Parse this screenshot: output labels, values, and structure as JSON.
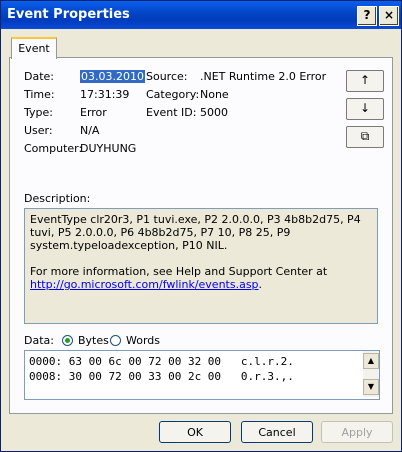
{
  "window": {
    "title": "Event Properties"
  },
  "titlebar": {
    "help": "?",
    "close": "×"
  },
  "tabs": [
    {
      "label": "Event"
    }
  ],
  "event": {
    "date_label": "Date:",
    "date": "03.03.2010",
    "time_label": "Time:",
    "time": "17:31:39",
    "type_label": "Type:",
    "type": "Error",
    "user_label": "User:",
    "user": "N/A",
    "computer_label": "Computer:",
    "computer": "DUYHUNG",
    "source_label": "Source:",
    "source": ".NET Runtime 2.0 Error",
    "category_label": "Category:",
    "category": "None",
    "eventid_label": "Event ID:",
    "eventid": "5000"
  },
  "side_buttons": {
    "up": "↑",
    "down": "↓",
    "copy": "⧉"
  },
  "description": {
    "label": "Description:",
    "text": "EventType clr20r3, P1 tuvi.exe, P2 2.0.0.0, P3 4b8b2d75, P4 tuvi, P5 2.0.0.0, P6 4b8b2d75, P7 10, P8 25, P9 system.typeloadexception, P10 NIL.",
    "more_info": "For more information, see Help and Support Center at",
    "link": "http://go.microsoft.com/fwlink/events.asp",
    "link_suffix": "."
  },
  "data_section": {
    "label": "Data:",
    "bytes_label": "Bytes",
    "words_label": "Words",
    "selected": "Bytes",
    "lines": [
      "0000: 63 00 6c 00 72 00 32 00   c.l.r.2.",
      "0008: 30 00 72 00 33 00 2c 00   0.r.3.,."
    ]
  },
  "buttons": {
    "ok": "OK",
    "cancel": "Cancel",
    "apply": "Apply"
  }
}
